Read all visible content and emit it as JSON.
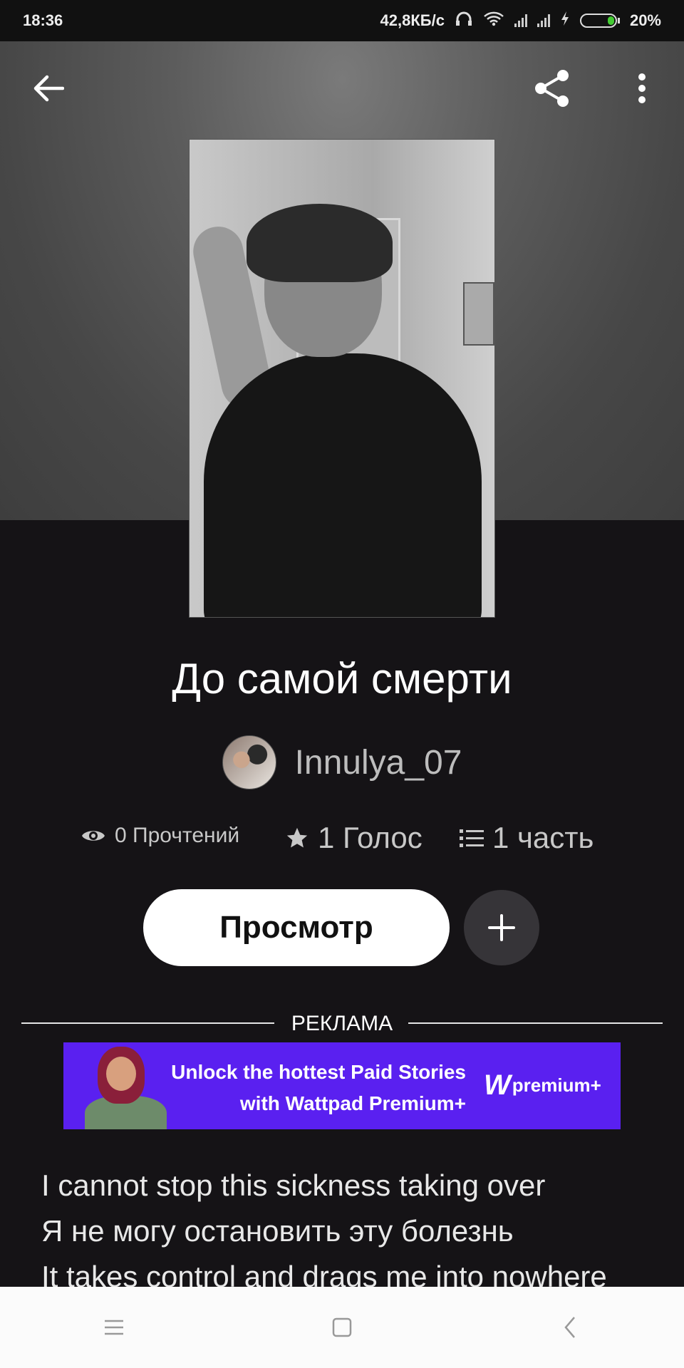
{
  "status_bar": {
    "time": "18:36",
    "network_speed": "42,8КБ/с",
    "battery_percent": "20%",
    "battery_level": 0.2
  },
  "toolbar": {
    "back_icon": "arrow-left-icon",
    "share_icon": "share-icon",
    "more_icon": "more-vertical-icon"
  },
  "story": {
    "title": "До самой смерти",
    "author": "Innulya_07",
    "stats": {
      "reads": "0 Прочтений",
      "votes": "1 Голос",
      "parts": "1 часть"
    },
    "view_button": "Просмотр",
    "add_button_icon": "plus-icon"
  },
  "ad": {
    "label": "РЕКЛАМА",
    "line1": "Unlock the hottest Paid Stories",
    "line2": "with Wattpad Premium+",
    "brand": "premium+",
    "brand_mark": "W",
    "banner_color": "#5a20f0"
  },
  "lyrics": [
    "I cannot stop this sickness taking over",
    "Я не могу остановить эту болезнь",
    "It takes control and drags me into nowhere"
  ],
  "nav": {
    "menu_icon": "menu-icon",
    "home_icon": "square-home-icon",
    "back_icon": "chevron-left-icon"
  }
}
